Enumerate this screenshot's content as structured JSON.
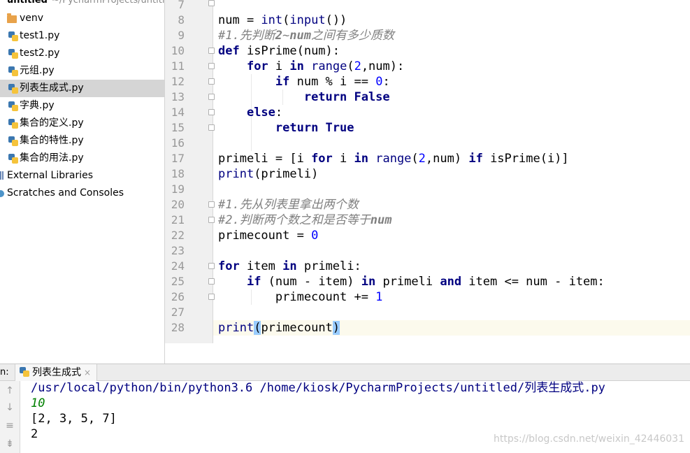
{
  "project_tree": {
    "root_name": "untitled",
    "root_path": "~/PycharmProjects/untitled",
    "items": [
      {
        "label": "venv",
        "type": "folder"
      },
      {
        "label": "test1.py",
        "type": "py"
      },
      {
        "label": "test2.py",
        "type": "py"
      },
      {
        "label": "元组.py",
        "type": "py"
      },
      {
        "label": "列表生成式.py",
        "type": "py",
        "selected": true
      },
      {
        "label": "字典.py",
        "type": "py"
      },
      {
        "label": "集合的定义.py",
        "type": "py"
      },
      {
        "label": "集合的特性.py",
        "type": "py"
      },
      {
        "label": "集合的用法.py",
        "type": "py"
      },
      {
        "label": "External Libraries",
        "type": "library"
      },
      {
        "label": "Scratches and Consoles",
        "type": "scratches"
      }
    ]
  },
  "editor": {
    "line_numbers": [
      "7",
      "8",
      "9",
      "10",
      "11",
      "12",
      "13",
      "14",
      "15",
      "16",
      "17",
      "18",
      "19",
      "20",
      "21",
      "22",
      "23",
      "24",
      "25",
      "26",
      "27",
      "28"
    ],
    "top_partial_text": "\"\"\"",
    "current_line": "28"
  },
  "run_panel": {
    "prefix": "n:",
    "tab_label": "列表生成式",
    "tab_close": "×",
    "toolbar_icons": [
      "up-arrow-icon",
      "down-arrow-icon",
      "soft-wrap-icon",
      "scroll-to-end-icon"
    ],
    "output_lines": [
      {
        "text": "/usr/local/python/bin/python3.6 /home/kiosk/PycharmProjects/untitled/列表生成式.py",
        "kind": "cmd"
      },
      {
        "text": "10",
        "kind": "input"
      },
      {
        "text": "[2, 3, 5, 7]",
        "kind": "stdout"
      },
      {
        "text": "2",
        "kind": "stdout"
      }
    ]
  },
  "watermark": "https://blog.csdn.net/weixin_42446031",
  "colors": {
    "keyword": "#000080",
    "number": "#0000ff",
    "comment": "#808080",
    "input_echo": "#008000",
    "selection": "#d5d5d5",
    "current_line": "#fcfaed"
  }
}
